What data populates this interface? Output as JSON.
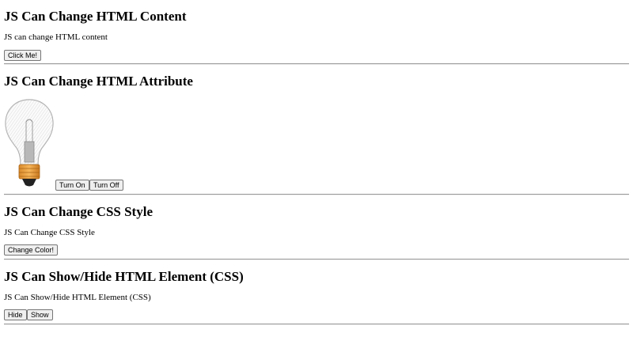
{
  "sections": [
    {
      "heading": "JS Can Change HTML Content",
      "text": "JS can change HTML content",
      "buttons": [
        "Click Me!"
      ]
    },
    {
      "heading": "JS Can Change HTML Attribute",
      "image": "lightbulb-off-icon",
      "buttons": [
        "Turn On",
        "Turn Off"
      ]
    },
    {
      "heading": "JS Can Change CSS Style",
      "text": "JS Can Change CSS Style",
      "buttons": [
        "Change Color!"
      ]
    },
    {
      "heading": "JS Can Show/Hide HTML Element (CSS)",
      "text": "JS Can Show/Hide HTML Element (CSS)",
      "buttons": [
        "Hide",
        "Show"
      ]
    }
  ],
  "colors": {
    "background": "#ffffff",
    "text": "#000000",
    "button_bg": "#efefef",
    "button_border": "#767676",
    "rule": "#9a9a9a",
    "bulb_base": "#f0a040"
  }
}
